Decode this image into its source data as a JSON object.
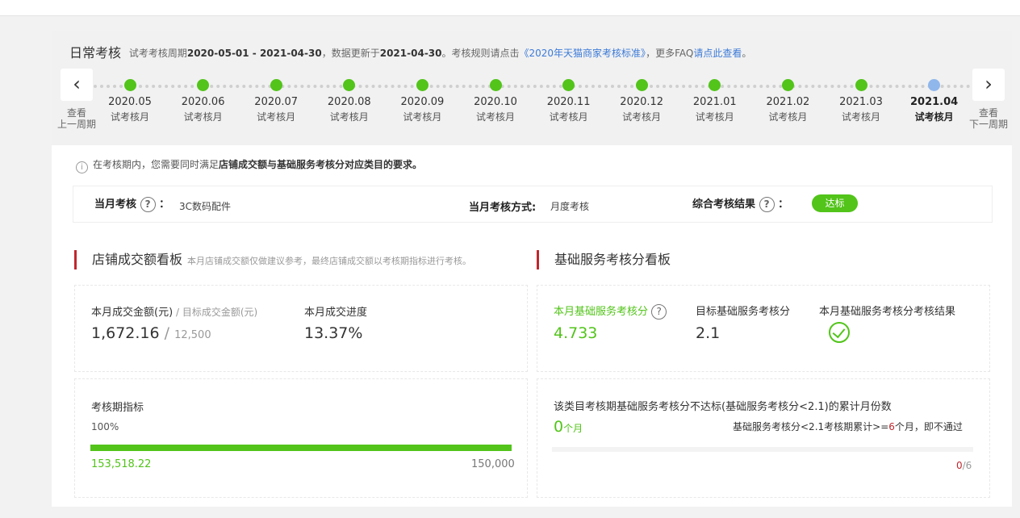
{
  "header": {
    "title": "日常考核",
    "desc_prefix": "试考考核周期",
    "period": "2020-05-01 - 2021-04-30",
    "desc_mid": "，数据更新于",
    "update_date": "2021-04-30",
    "desc_mid2": "。考核规则请点击",
    "rule_link": "《2020年天猫商家考核标准》",
    "desc_mid3": "，更多FAQ",
    "faq_link": "请点此查看",
    "desc_end": "。"
  },
  "nav": {
    "prev_line1": "查看",
    "prev_line2": "上一周期",
    "next_line1": "查看",
    "next_line2": "下一周期",
    "prev_icon": "chevron-left-icon",
    "next_icon": "chevron-right-icon"
  },
  "timeline": [
    {
      "date": "2020.05",
      "label": "试考核月"
    },
    {
      "date": "2020.06",
      "label": "试考核月"
    },
    {
      "date": "2020.07",
      "label": "试考核月"
    },
    {
      "date": "2020.08",
      "label": "试考核月"
    },
    {
      "date": "2020.09",
      "label": "试考核月"
    },
    {
      "date": "2020.10",
      "label": "试考核月"
    },
    {
      "date": "2020.11",
      "label": "试考核月"
    },
    {
      "date": "2020.12",
      "label": "试考核月"
    },
    {
      "date": "2021.01",
      "label": "试考核月"
    },
    {
      "date": "2021.02",
      "label": "试考核月"
    },
    {
      "date": "2021.03",
      "label": "试考核月"
    },
    {
      "date": "2021.04",
      "label": "试考核月",
      "current": true
    }
  ],
  "notice": {
    "prefix": "在考核期内，您需要同时满足",
    "bold": "店铺成交额与基础服务考核分对应类目的要求。"
  },
  "exam": {
    "month_label": "当月考核",
    "colon": "：",
    "category": "3C数码配件",
    "method_label": "当月考核方式:",
    "method_value": "月度考核",
    "result_label": "综合考核结果",
    "result_colon": "：",
    "result_badge": "达标"
  },
  "left_panel": {
    "title": "店铺成交额看板",
    "subtitle": "本月店铺成交额仅做建议参考，最终店铺成交额以考核期指标进行考核。",
    "amount_label": "本月成交金额(元)",
    "target_label": " / 目标成交金额(元)",
    "amount_value": "1,672.16",
    "slash": "/",
    "target_value": "12,500",
    "progress_label": "本月成交进度",
    "progress_value": "13.37%",
    "period_label": "考核期指标",
    "period_percent": "100%",
    "period_fraction": 1.0,
    "period_actual": "153,518.22",
    "period_target": "150,000"
  },
  "right_panel": {
    "title": "基础服务考核分看板",
    "score_label": "本月基础服务考核分",
    "score_value": "4.733",
    "target_score_label": "目标基础服务考核分",
    "target_score_value": "2.1",
    "result_label": "本月基础服务考核分考核结果",
    "fail_desc": "该类目考核期基础服务考核分不达标(基础服务考核分<2.1)的累计月份数",
    "fail_count": "0",
    "fail_unit": "个月",
    "rule_prefix": "基础服务考核分<2.1考核期累计>=",
    "rule_num": "6",
    "rule_suffix": "个月，即不通过",
    "ratio_current": "0",
    "ratio_total": "/6",
    "fail_fraction": 0
  },
  "colors": {
    "green": "#52c41a",
    "red_accent": "#c0272d",
    "link_blue": "#3d7bd8",
    "current_dot": "#8fb7ec"
  }
}
